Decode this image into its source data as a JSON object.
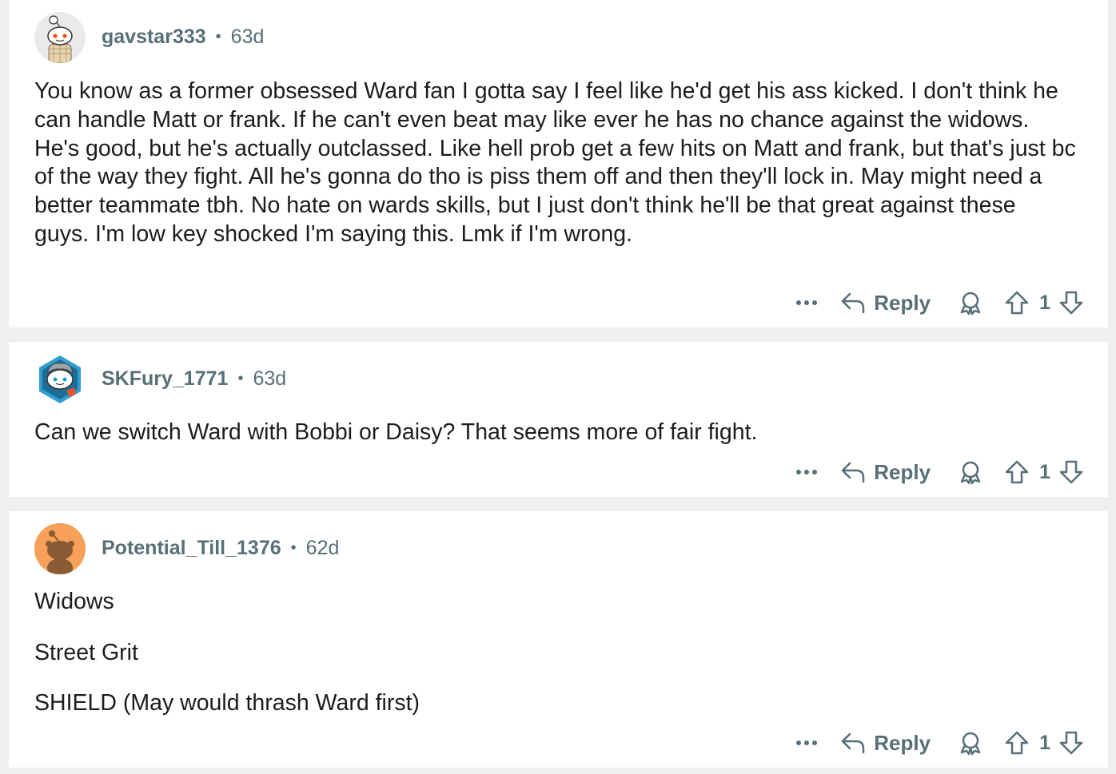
{
  "comments": [
    {
      "username": "gavstar333",
      "age": "63d",
      "avatar_bg": "#e9eaec",
      "paragraphs": [
        "You know as a former obsessed Ward fan I gotta say I feel like he'd get his ass kicked. I don't think he can handle Matt or frank. If he can't even beat may like ever he has no chance against the widows. He's good, but he's actually outclassed. Like hell prob get a few hits on Matt and frank, but that's just bc of the way they fight. All he's gonna do tho is piss them off and then they'll lock in. May might need a better teammate tbh. No hate on wards skills, but I just don't think he'll be that great against these guys. I'm low key shocked I'm saying this. Lmk if I'm wrong."
      ],
      "more_label": "•••",
      "reply_label": "Reply",
      "score": "1"
    },
    {
      "username": "SKFury_1771",
      "age": "63d",
      "avatar_bg": "#2f9fd1",
      "paragraphs": [
        "Can we switch Ward with Bobbi or Daisy? That seems more of fair fight."
      ],
      "more_label": "•••",
      "reply_label": "Reply",
      "score": "1"
    },
    {
      "username": "Potential_Till_1376",
      "age": "62d",
      "avatar_bg": "#f6a05a",
      "paragraphs": [
        "Widows",
        "Street Grit",
        "SHIELD (May would thrash Ward first)"
      ],
      "more_label": "•••",
      "reply_label": "Reply",
      "score": "1"
    }
  ],
  "separator": "•",
  "colors": {
    "page_bg": "#edeff1",
    "card_bg": "#ffffff",
    "meta_text": "#576f76",
    "body_text": "#1c1c1c"
  },
  "icons": [
    "more-icon",
    "reply-arrow-icon",
    "award-icon",
    "upvote-arrow-icon",
    "downvote-arrow-icon"
  ]
}
